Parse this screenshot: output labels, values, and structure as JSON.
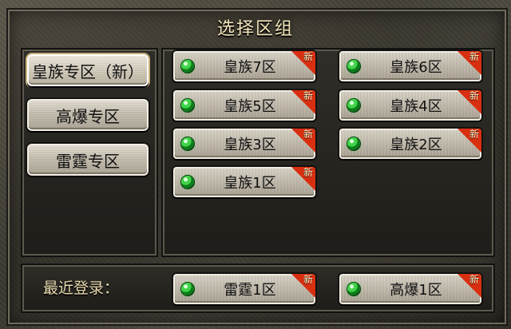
{
  "title": "选择区组",
  "sidebar": {
    "items": [
      {
        "label": "皇族专区（新）",
        "active": true
      },
      {
        "label": "高爆专区",
        "active": false
      },
      {
        "label": "雷霆专区",
        "active": false
      }
    ]
  },
  "servers": [
    {
      "label": "皇族7区",
      "badge": "新",
      "status": "online"
    },
    {
      "label": "皇族6区",
      "badge": "新",
      "status": "online"
    },
    {
      "label": "皇族5区",
      "badge": "新",
      "status": "online"
    },
    {
      "label": "皇族4区",
      "badge": "新",
      "status": "online"
    },
    {
      "label": "皇族3区",
      "badge": "新",
      "status": "online"
    },
    {
      "label": "皇族2区",
      "badge": "新",
      "status": "online"
    },
    {
      "label": "皇族1区",
      "badge": "新",
      "status": "online"
    }
  ],
  "recent": {
    "label": "最近登录：",
    "servers": [
      {
        "label": "雷霆1区",
        "badge": "新",
        "status": "online"
      },
      {
        "label": "高爆1区",
        "badge": "新",
        "status": "online"
      }
    ]
  },
  "icons": {
    "status": "green-status-icon",
    "badge": "new-badge-icon"
  },
  "colors": {
    "title": "#efe2b7",
    "badge": "#d92f11",
    "status_green": "#41d34a"
  }
}
